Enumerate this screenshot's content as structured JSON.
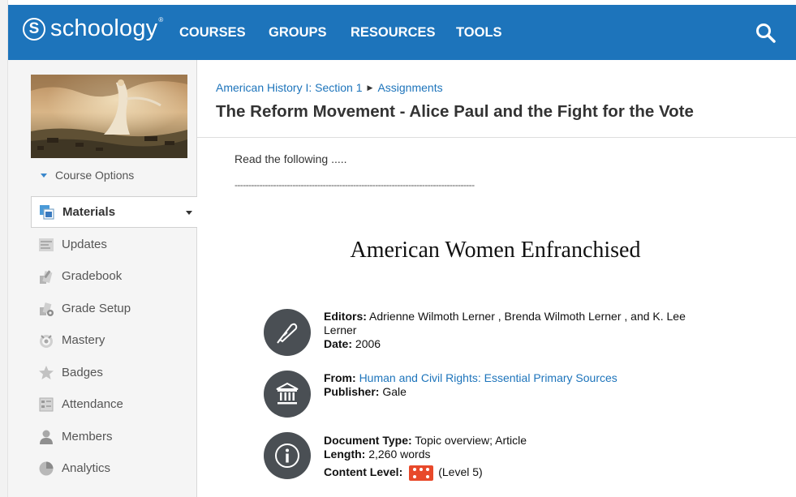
{
  "app": {
    "logo_text": "schoology",
    "logo_mark": "S"
  },
  "nav": {
    "items": [
      "COURSES",
      "GROUPS",
      "RESOURCES",
      "TOOLS"
    ]
  },
  "sidebar": {
    "course_options": "Course Options",
    "items": [
      {
        "label": "Materials",
        "icon": "materials-icon"
      },
      {
        "label": "Updates",
        "icon": "updates-icon"
      },
      {
        "label": "Gradebook",
        "icon": "gradebook-icon"
      },
      {
        "label": "Grade Setup",
        "icon": "grade-setup-icon"
      },
      {
        "label": "Mastery",
        "icon": "mastery-icon"
      },
      {
        "label": "Badges",
        "icon": "badges-icon"
      },
      {
        "label": "Attendance",
        "icon": "attendance-icon"
      },
      {
        "label": "Members",
        "icon": "members-icon"
      },
      {
        "label": "Analytics",
        "icon": "analytics-icon"
      }
    ]
  },
  "breadcrumb": {
    "course": "American History I: Section 1",
    "section": "Assignments"
  },
  "page": {
    "title": "The Reform Movement - Alice Paul and the Fight for the Vote",
    "intro": "Read the following .....",
    "separator": "---------------------------------------------------------------------------------------"
  },
  "document": {
    "title": "American Women Enfranchised",
    "editors_label": "Editors:",
    "editors_value": "Adrienne Wilmoth Lerner , Brenda Wilmoth Lerner , and K. Lee Lerner",
    "date_label": "Date:",
    "date_value": "2006",
    "from_label": "From:",
    "from_value": "Human and Civil Rights: Essential Primary Sources",
    "publisher_label": "Publisher:",
    "publisher_value": "Gale",
    "doctype_label": "Document Type:",
    "doctype_value": "Topic overview; Article",
    "length_label": "Length:",
    "length_value": "2,260 words",
    "content_level_label": "Content Level:",
    "content_level_value": "(Level 5)"
  },
  "colors": {
    "header": "#1d74bb",
    "link": "#1d74bb",
    "icon_circle": "#4a4f54",
    "level_badge": "#e8492a"
  }
}
